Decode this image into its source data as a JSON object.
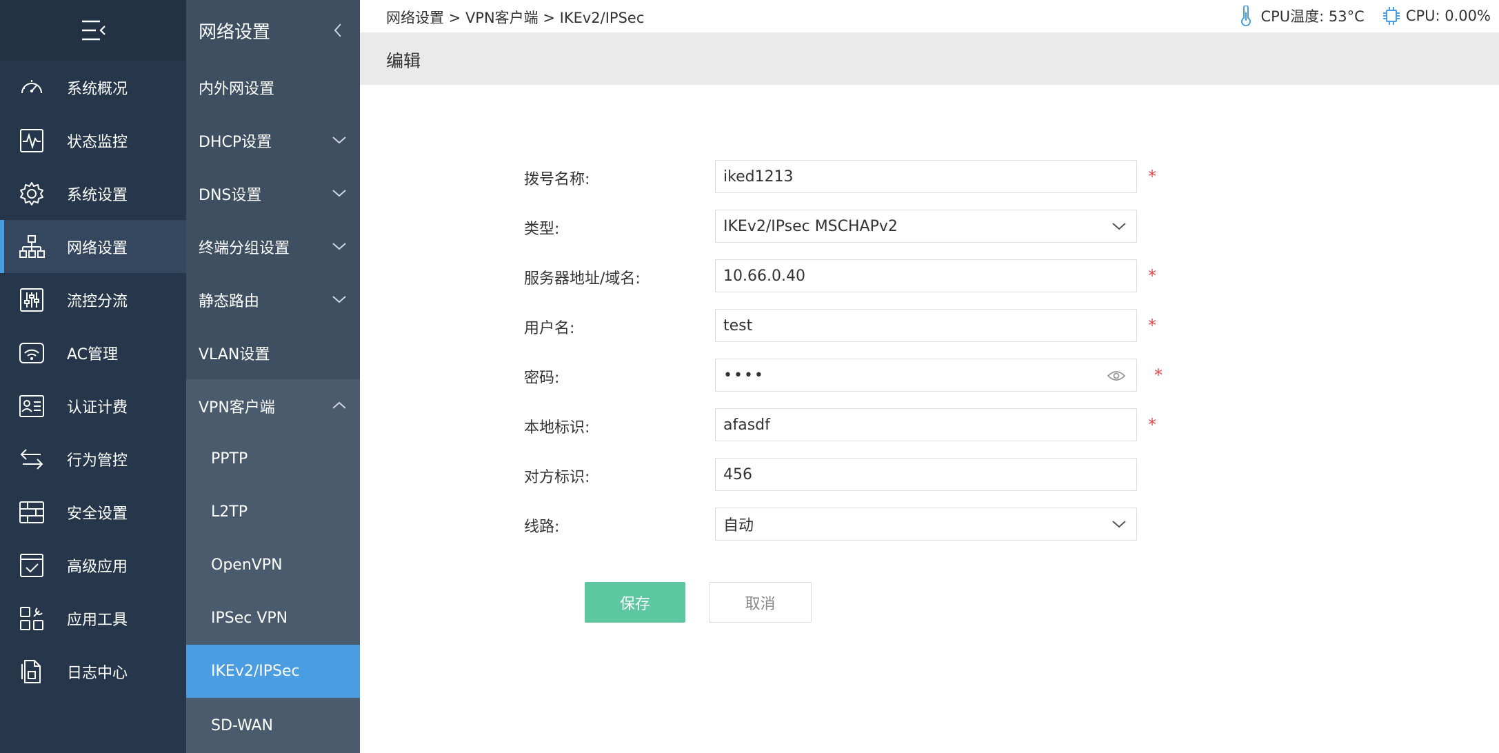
{
  "breadcrumb": "网络设置 > VPN客户端 > IKEv2/IPSec",
  "status": {
    "cpu_temp": "CPU温度: 53°C",
    "cpu_usage": "CPU: 0.00%"
  },
  "main_nav": {
    "items": [
      {
        "label": "系统概况",
        "icon": "dashboard-icon"
      },
      {
        "label": "状态监控",
        "icon": "monitor-icon"
      },
      {
        "label": "系统设置",
        "icon": "gear-icon"
      },
      {
        "label": "网络设置",
        "icon": "network-icon"
      },
      {
        "label": "流控分流",
        "icon": "sliders-icon"
      },
      {
        "label": "AC管理",
        "icon": "wifi-icon"
      },
      {
        "label": "认证计费",
        "icon": "id-card-icon"
      },
      {
        "label": "行为管控",
        "icon": "arrows-icon"
      },
      {
        "label": "安全设置",
        "icon": "firewall-icon"
      },
      {
        "label": "高级应用",
        "icon": "checklist-icon"
      },
      {
        "label": "应用工具",
        "icon": "tools-icon"
      },
      {
        "label": "日志中心",
        "icon": "document-icon"
      }
    ],
    "active_index": 3
  },
  "sub_nav": {
    "title": "网络设置",
    "items": [
      {
        "label": "内外网设置"
      },
      {
        "label": "DHCP设置"
      },
      {
        "label": "DNS设置"
      },
      {
        "label": "终端分组设置"
      },
      {
        "label": "静态路由"
      },
      {
        "label": "VLAN设置"
      },
      {
        "label": "VPN客户端"
      }
    ],
    "vpn_children": [
      {
        "label": "PPTP"
      },
      {
        "label": "L2TP"
      },
      {
        "label": "OpenVPN"
      },
      {
        "label": "IPSec VPN"
      },
      {
        "label": "IKEv2/IPSec"
      },
      {
        "label": "SD-WAN"
      }
    ]
  },
  "edit": {
    "title": "编辑"
  },
  "form": {
    "dial_name": {
      "label": "拨号名称:",
      "value": "iked1213"
    },
    "type": {
      "label": "类型:",
      "value": "IKEv2/IPsec MSCHAPv2"
    },
    "server": {
      "label": "服务器地址/域名:",
      "value": "10.66.0.40"
    },
    "username": {
      "label": "用户名:",
      "value": "test"
    },
    "password": {
      "label": "密码:",
      "value": "••••"
    },
    "local_id": {
      "label": "本地标识:",
      "value": "afasdf"
    },
    "remote_id": {
      "label": "对方标识:",
      "value": "456"
    },
    "line": {
      "label": "线路:",
      "value": "自动"
    },
    "required_mark": "*"
  },
  "buttons": {
    "save": "保存",
    "cancel": "取消"
  },
  "colors": {
    "sidebar_bg": "#26374b",
    "subnav_bg": "#3e4f62",
    "accent": "#4a9de0",
    "save_btn": "#5dc7a0",
    "required": "#e54848"
  }
}
